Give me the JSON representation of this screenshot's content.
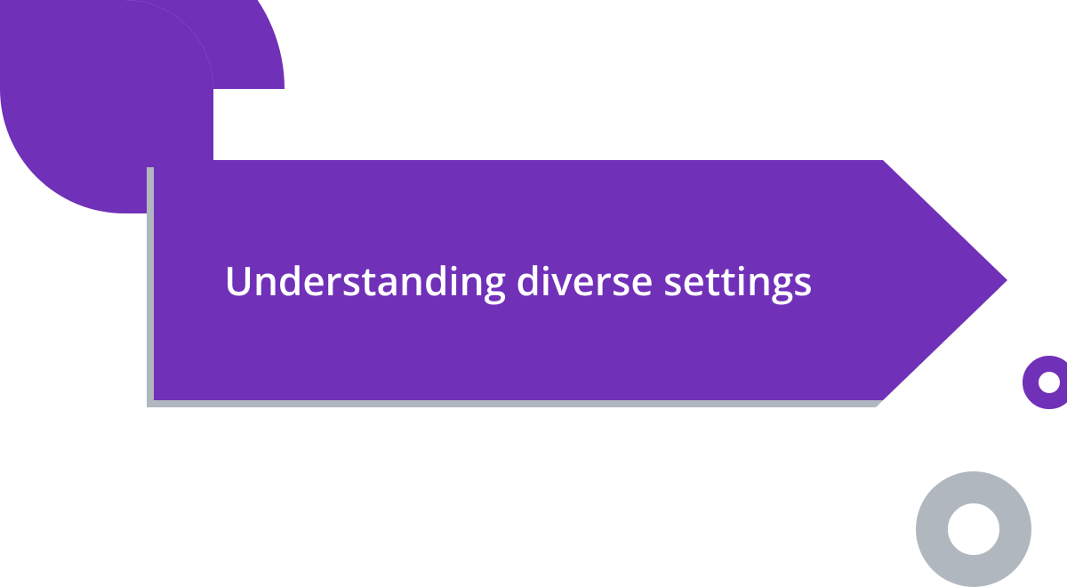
{
  "banner": {
    "title": "Understanding diverse settings"
  },
  "colors": {
    "primary": "#7030b8",
    "shadow": "#b0b7bf",
    "grey": "#b0b7bf"
  }
}
